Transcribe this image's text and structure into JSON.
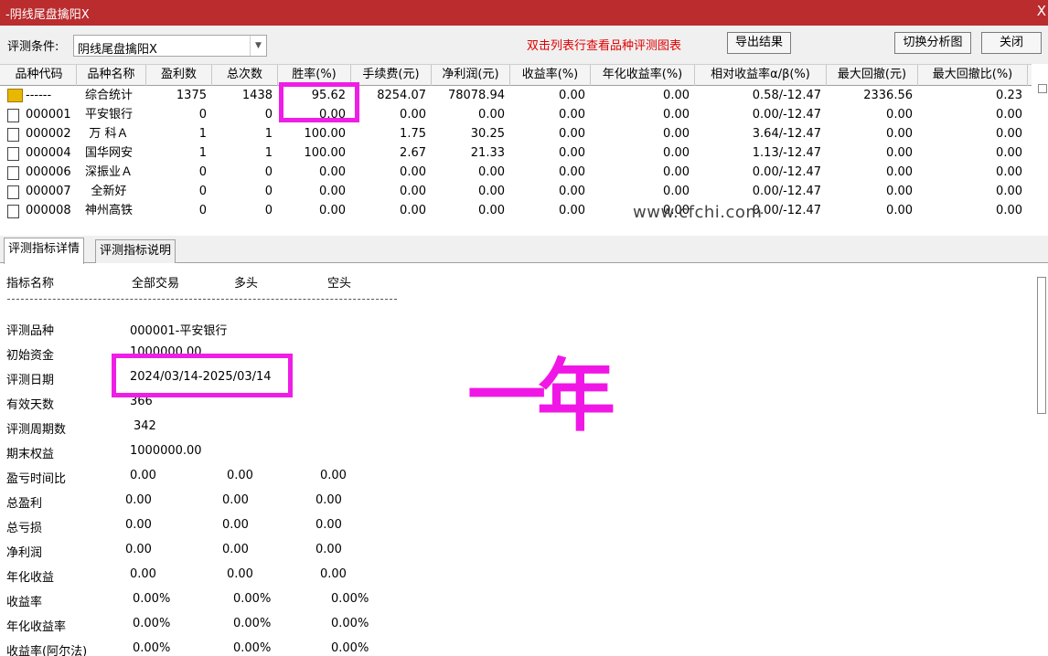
{
  "window": {
    "title": "-阴线尾盘擒阳X",
    "close_glyph": "X"
  },
  "toolbar": {
    "condition_label": "评测条件:",
    "condition_value": "阴线尾盘擒阳X",
    "hint": "双击列表行查看品种评测图表",
    "export_button": "导出结果",
    "switch_button": "切换分析图",
    "close_button": "关闭"
  },
  "table": {
    "columns": [
      "品种代码",
      "品种名称",
      "盈利数",
      "总次数",
      "胜率(%)",
      "手续费(元)",
      "净利润(元)",
      "收益率(%)",
      "年化收益率(%)",
      "相对收益率α/β(%)",
      "最大回撤(元)",
      "最大回撤比(%)"
    ],
    "rows": [
      [
        "------",
        "综合统计",
        "1375",
        "1438",
        "95.62",
        "8254.07",
        "78078.94",
        "0.00",
        "0.00",
        "0.58/-12.47",
        "2336.56",
        "0.23"
      ],
      [
        "000001",
        "平安银行",
        "0",
        "0",
        "0.00",
        "0.00",
        "0.00",
        "0.00",
        "0.00",
        "0.00/-12.47",
        "0.00",
        "0.00"
      ],
      [
        "000002",
        "万 科Ａ",
        "1",
        "1",
        "100.00",
        "1.75",
        "30.25",
        "0.00",
        "0.00",
        "3.64/-12.47",
        "0.00",
        "0.00"
      ],
      [
        "000004",
        "国华网安",
        "1",
        "1",
        "100.00",
        "2.67",
        "21.33",
        "0.00",
        "0.00",
        "1.13/-12.47",
        "0.00",
        "0.00"
      ],
      [
        "000006",
        "深振业Ａ",
        "0",
        "0",
        "0.00",
        "0.00",
        "0.00",
        "0.00",
        "0.00",
        "0.00/-12.47",
        "0.00",
        "0.00"
      ],
      [
        "000007",
        "全新好",
        "0",
        "0",
        "0.00",
        "0.00",
        "0.00",
        "0.00",
        "0.00",
        "0.00/-12.47",
        "0.00",
        "0.00"
      ],
      [
        "000008",
        "神州高铁",
        "0",
        "0",
        "0.00",
        "0.00",
        "0.00",
        "0.00",
        "0.00",
        "0.00/-12.47",
        "0.00",
        "0.00"
      ]
    ],
    "watermark": "www.cfchi.com"
  },
  "tabs": [
    "评测指标详情",
    "评测指标说明"
  ],
  "detail": {
    "headers": [
      "指标名称",
      "全部交易",
      "多头",
      "空头"
    ],
    "separator": "-------------------------------------------------------------------",
    "stock_label": "评测品种",
    "stock_value": "000001-平安银行",
    "capital_label": "初始资金",
    "capital_value": "1000000.00",
    "date_label": "评测日期",
    "date_value": "2024/03/14-2025/03/14",
    "days_label": "有效天数",
    "days_value": "366",
    "periods_label": "评测周期数",
    "periods_value": "342",
    "equity_label": "期末权益",
    "equity_value": "1000000.00",
    "metrics": [
      [
        "盈亏时间比",
        "0.00",
        "0.00",
        "0.00"
      ],
      [
        "总盈利",
        "0.00",
        "0.00",
        "0.00"
      ],
      [
        "总亏损",
        "0.00",
        "0.00",
        "0.00"
      ],
      [
        "净利润",
        "0.00",
        "0.00",
        "0.00"
      ],
      [
        "年化收益",
        "0.00",
        "0.00",
        "0.00"
      ],
      [
        "收益率",
        "0.00%",
        "0.00%",
        "0.00%"
      ],
      [
        "年化收益率",
        "0.00%",
        "0.00%",
        "0.00%"
      ],
      [
        "收益率(阿尔法)",
        "0.00%",
        "0.00%",
        "0.00%"
      ]
    ]
  },
  "annotation": {
    "text": "一年",
    "color": "#ee1ee6"
  }
}
